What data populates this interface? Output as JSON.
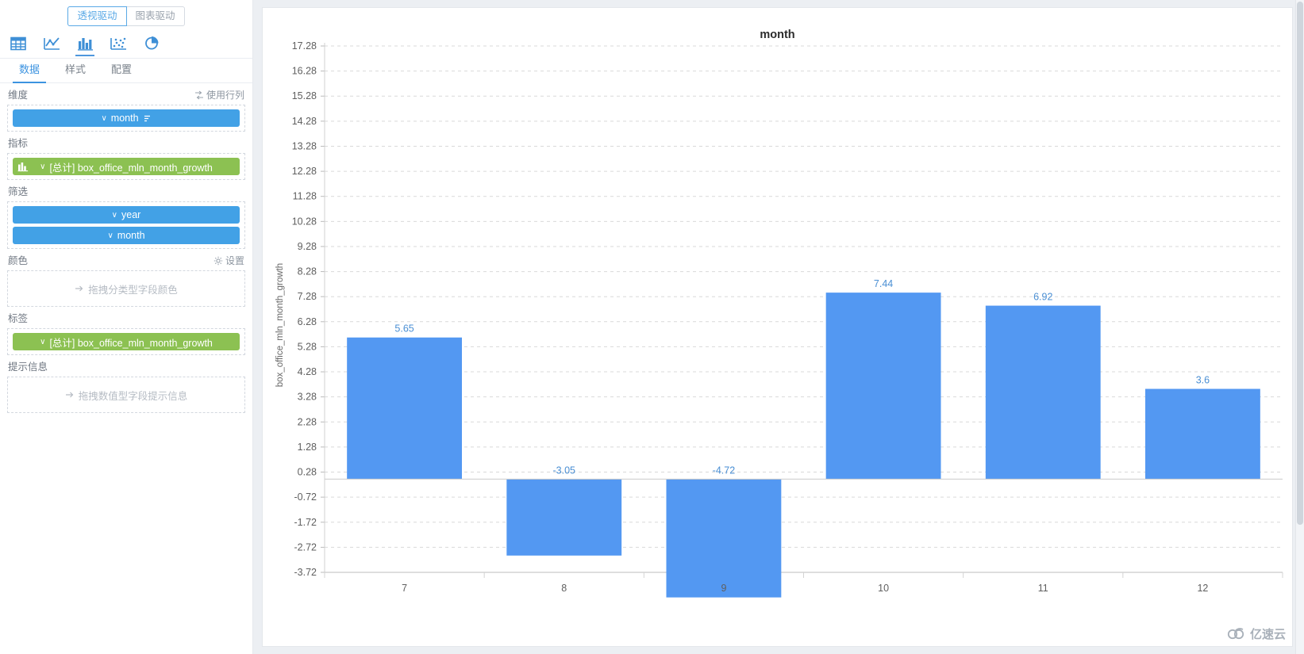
{
  "sidebar": {
    "drive_tabs": [
      {
        "label": "透视驱动",
        "active": true
      },
      {
        "label": "图表驱动",
        "active": false
      }
    ],
    "chart_type_icons": [
      {
        "name": "table-icon",
        "active": false
      },
      {
        "name": "line-chart-icon",
        "active": false
      },
      {
        "name": "bar-chart-icon",
        "active": true
      },
      {
        "name": "scatter-chart-icon",
        "active": false
      },
      {
        "name": "pie-chart-icon",
        "active": false
      }
    ],
    "panel_tabs": [
      {
        "label": "数据",
        "active": true
      },
      {
        "label": "样式",
        "active": false
      },
      {
        "label": "配置",
        "active": false
      }
    ],
    "sections": [
      {
        "title": "维度",
        "action": "使用行列",
        "action_icon": "swap-rows-columns-icon",
        "fields": [
          {
            "label": "month",
            "color": "blue",
            "sort_icon": true,
            "lead_icon": null
          }
        ],
        "placeholder": null
      },
      {
        "title": "指标",
        "action": null,
        "fields": [
          {
            "label": "[总计] box_office_mln_month_growth",
            "color": "green",
            "sort_icon": false,
            "lead_icon": "bar-chart-icon"
          }
        ],
        "placeholder": null
      },
      {
        "title": "筛选",
        "action": null,
        "fields": [
          {
            "label": "year",
            "color": "blue",
            "sort_icon": false,
            "lead_icon": null
          },
          {
            "label": "month",
            "color": "blue",
            "sort_icon": false,
            "lead_icon": null
          }
        ],
        "placeholder": null
      },
      {
        "title": "颜色",
        "action": "设置",
        "action_icon": "gear-icon",
        "fields": [],
        "placeholder": "拖拽分类型字段颜色"
      },
      {
        "title": "标签",
        "action": null,
        "fields": [
          {
            "label": "[总计] box_office_mln_month_growth",
            "color": "green",
            "sort_icon": false,
            "lead_icon": null
          }
        ],
        "placeholder": null
      },
      {
        "title": "提示信息",
        "action": null,
        "fields": [],
        "placeholder": "拖拽数值型字段提示信息"
      }
    ]
  },
  "watermark": {
    "text": "亿速云",
    "icon": "cloud-icon"
  },
  "colors": {
    "bar": "#5398f2",
    "label": "#4a8fd4",
    "blue_pill": "#42a1e6",
    "green_pill": "#8cc152",
    "accent": "#3c93e0",
    "grid": "#d9d9d9"
  },
  "chart_data": {
    "type": "bar",
    "title": "month",
    "xlabel": "",
    "ylabel": "box_office_mln_month_growth",
    "categories": [
      "7",
      "8",
      "9",
      "10",
      "11",
      "12"
    ],
    "values": [
      5.65,
      -3.05,
      -4.72,
      7.44,
      6.92,
      3.6
    ],
    "data_labels": [
      "5.65",
      "-3.05",
      "-4.72",
      "7.44",
      "6.92",
      "3.6"
    ],
    "ylim": [
      -3.72,
      17.28
    ],
    "yticks": [
      -3.72,
      -2.72,
      -1.72,
      -0.72,
      0.28,
      1.28,
      2.28,
      3.28,
      4.28,
      5.28,
      6.28,
      7.28,
      8.28,
      9.28,
      10.28,
      11.28,
      12.28,
      13.28,
      14.28,
      15.28,
      16.28,
      17.28
    ],
    "ytick_labels": [
      "-3.72",
      "-2.72",
      "-1.72",
      "-0.72",
      "0.28",
      "1.28",
      "2.28",
      "3.28",
      "4.28",
      "5.28",
      "6.28",
      "7.28",
      "8.28",
      "9.28",
      "10.28",
      "11.28",
      "12.28",
      "13.28",
      "14.28",
      "15.28",
      "16.28",
      "17.28"
    ],
    "grid": true,
    "grid_style": "dashed",
    "legend": "none",
    "baseline": 0
  }
}
